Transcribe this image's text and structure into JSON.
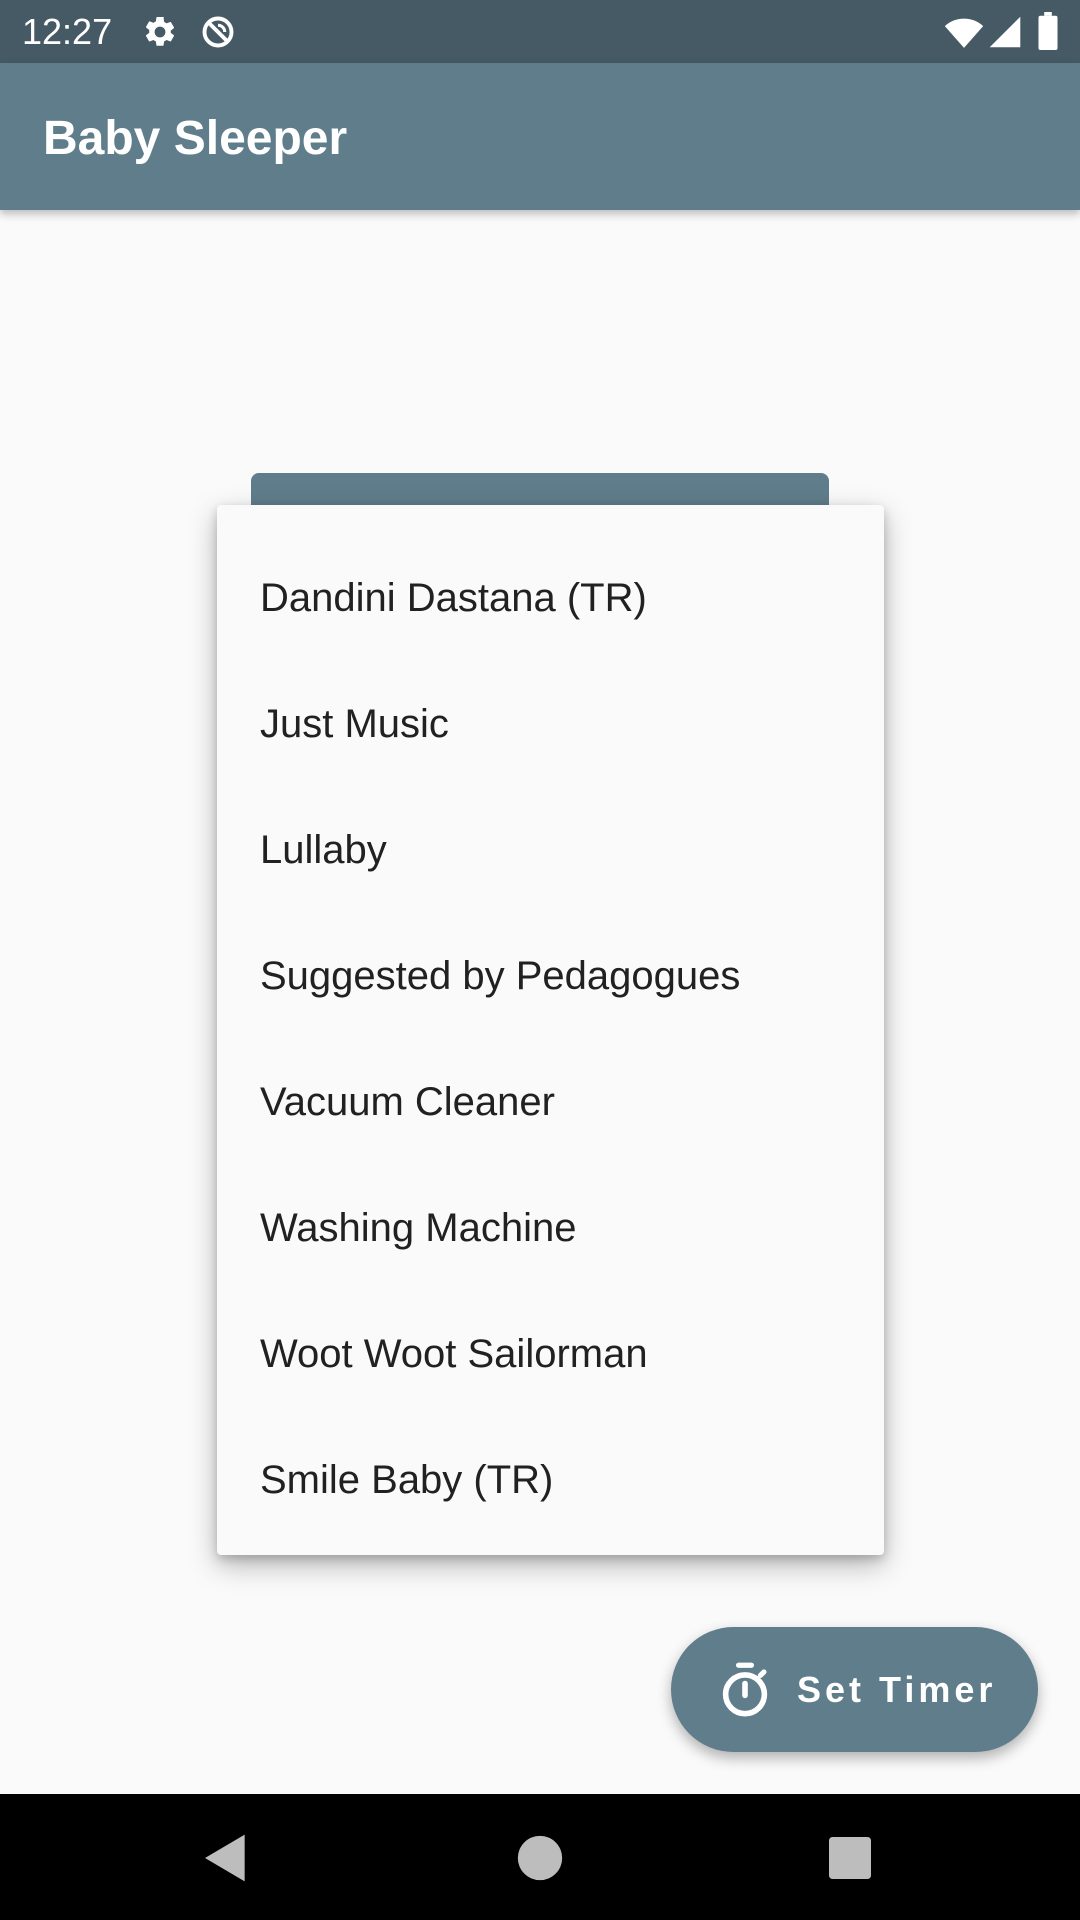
{
  "status_bar": {
    "time": "12:27",
    "icons": [
      "gear-icon",
      "do-not-disturb-icon",
      "wifi-icon",
      "signal-icon",
      "battery-icon"
    ],
    "background": "#455a64"
  },
  "app_bar": {
    "title": "Baby Sleeper",
    "background": "#607d8b"
  },
  "dropdown": {
    "items": [
      {
        "label": "Dandini Dastana (TR)"
      },
      {
        "label": "Just Music"
      },
      {
        "label": "Lullaby"
      },
      {
        "label": "Suggested by Pedagogues"
      },
      {
        "label": "Vacuum Cleaner"
      },
      {
        "label": "Washing Machine"
      },
      {
        "label": "Woot Woot Sailorman"
      },
      {
        "label": "Smile Baby (TR)"
      }
    ]
  },
  "fab": {
    "label": "Set Timer",
    "icon": "timer-icon",
    "background": "#607d8b"
  },
  "nav_bar": {
    "buttons": [
      "back-icon",
      "home-icon",
      "recents-icon"
    ]
  }
}
